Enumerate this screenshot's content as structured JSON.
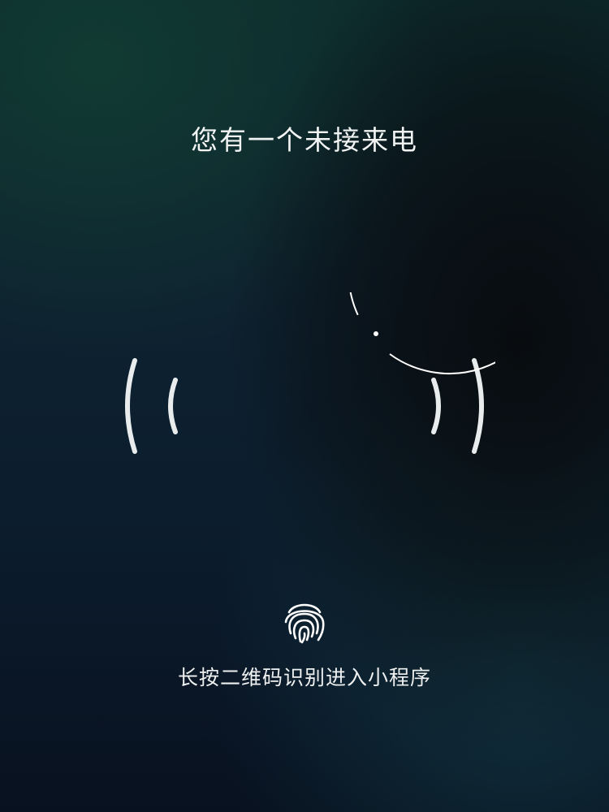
{
  "call_screen": {
    "title": "您有一个未接来电",
    "hint": "长按二维码识别进入小程序"
  },
  "icons": {
    "ring": "call-ring-icon",
    "sound_waves": "sound-wave-icon",
    "fingerprint": "fingerprint-icon"
  },
  "colors": {
    "text": "#f2f4f4",
    "stroke": "#ffffff"
  }
}
